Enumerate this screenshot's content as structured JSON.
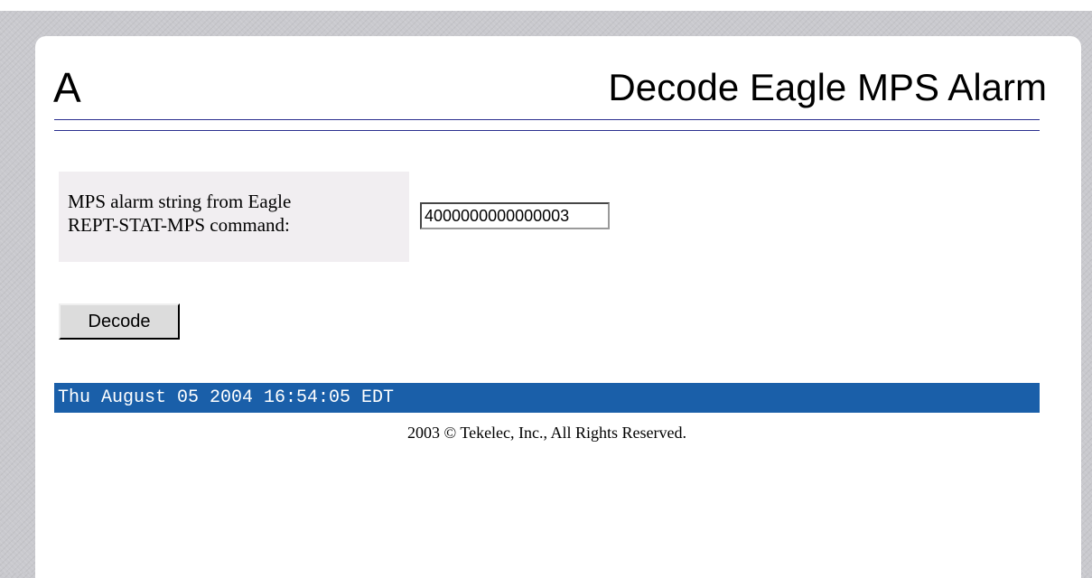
{
  "header": {
    "letter": "A",
    "title": "Decode Eagle MPS Alarm"
  },
  "form": {
    "label": "MPS alarm string from Eagle\nREPT-STAT-MPS command:",
    "input_value": "4000000000000003"
  },
  "actions": {
    "decode_label": "Decode"
  },
  "status": {
    "timestamp": "Thu August 05 2004 16:54:05 EDT"
  },
  "footer": {
    "copyright": "2003 © Tekelec, Inc., All Rights Reserved."
  },
  "colors": {
    "status_bar": "#1a5fa9",
    "rule": "#2b2f8f",
    "label_cell": "#f1eef1",
    "backdrop": "#c9c9ce"
  }
}
